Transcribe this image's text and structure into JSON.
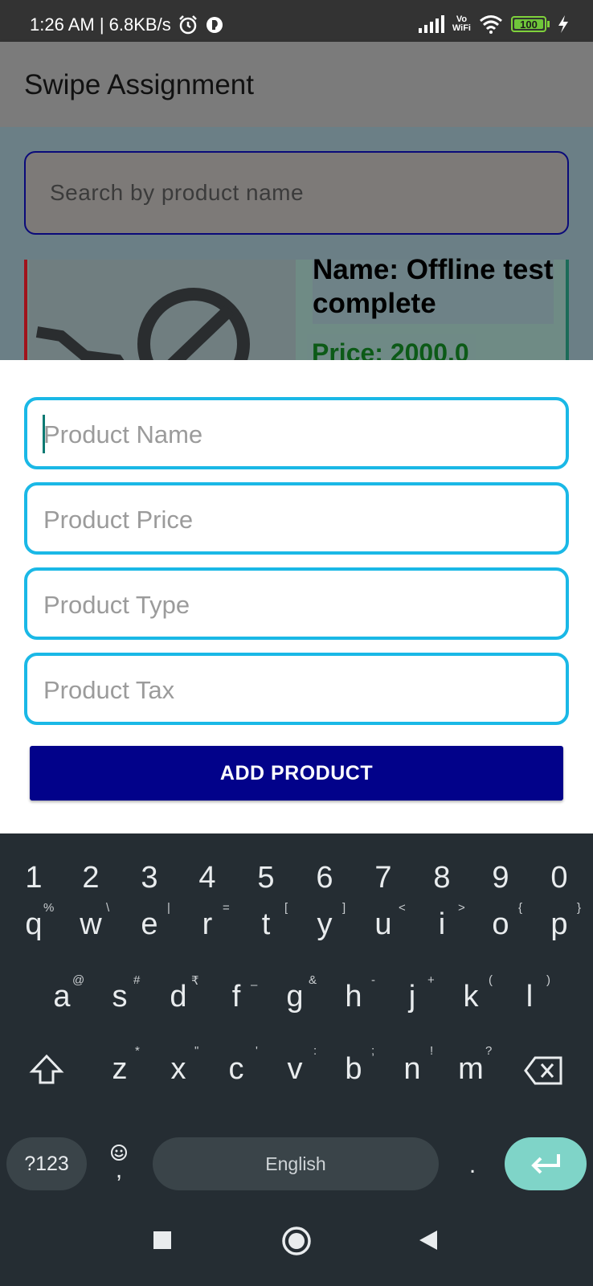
{
  "status_bar": {
    "time_speed": "1:26 AM | 6.8KB/s",
    "vowifi_top": "Vo",
    "vowifi_bottom": "WiFi",
    "battery": "100"
  },
  "app_bar": {
    "title": "Swipe Assignment"
  },
  "search": {
    "placeholder": "Search by product name"
  },
  "product_card": {
    "name": "Name: Offline test complete",
    "price": "Price: 2000.0"
  },
  "form": {
    "fields": [
      {
        "placeholder": "Product Name"
      },
      {
        "placeholder": "Product Price"
      },
      {
        "placeholder": "Product Type"
      },
      {
        "placeholder": "Product Tax"
      }
    ],
    "submit_label": "ADD PRODUCT"
  },
  "keyboard": {
    "number_row": [
      "1",
      "2",
      "3",
      "4",
      "5",
      "6",
      "7",
      "8",
      "9",
      "0"
    ],
    "row1": [
      "q",
      "w",
      "e",
      "r",
      "t",
      "y",
      "u",
      "i",
      "o",
      "p"
    ],
    "row1_hints": [
      "%",
      "\\",
      "|",
      "=",
      "[",
      "]",
      "<",
      ">",
      "{",
      "}"
    ],
    "row2": [
      "a",
      "s",
      "d",
      "f",
      "g",
      "h",
      "j",
      "k",
      "l"
    ],
    "row2_hints": [
      "@",
      "#",
      "₹",
      "–",
      "&",
      "-",
      "+",
      "(",
      ")"
    ],
    "row3": [
      "z",
      "x",
      "c",
      "v",
      "b",
      "n",
      "m"
    ],
    "row3_hints": [
      "*",
      "\"",
      "'",
      ":",
      ";",
      "!",
      "?"
    ],
    "symbols_label": "?123",
    "comma": ",",
    "space_label": "English",
    "period": ".",
    "icons": [
      "shift-icon",
      "backspace-icon",
      "emoji-icon",
      "enter-icon"
    ]
  },
  "nav_bar": {
    "icons": [
      "recents-icon",
      "home-icon",
      "back-icon"
    ]
  },
  "colors": {
    "field_border": "#1ab8e6",
    "button_bg": "#02028a",
    "keyboard_bg": "#252d33",
    "enter_key": "#7fd4c8"
  }
}
